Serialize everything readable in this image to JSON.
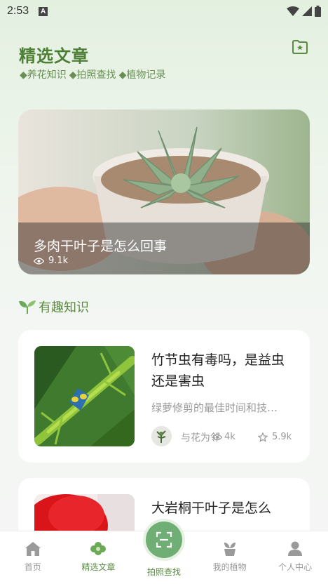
{
  "status": {
    "time": "2:53",
    "notif_letter": "A"
  },
  "header": {
    "title": "精选文章",
    "tags": [
      "◆养花知识",
      "◆拍照查找",
      "◆植物记录"
    ]
  },
  "hero": {
    "title": "多肉干叶子是怎么回事",
    "views": "9.1k"
  },
  "section": {
    "title": "有趣知识"
  },
  "cards": [
    {
      "title": "竹节虫有毒吗，是益虫还是害虫",
      "desc": "绿萝修剪的最佳时间和技…",
      "author": "与花为邻",
      "views": "4k",
      "stars": "5.9k"
    },
    {
      "title": "大岩桐干叶子是怎么"
    }
  ],
  "tabs": [
    {
      "label": "首页",
      "icon": "home-icon"
    },
    {
      "label": "精选文章",
      "icon": "flower-icon"
    },
    {
      "label": "拍照查找",
      "icon": "scan-icon"
    },
    {
      "label": "我的植物",
      "icon": "plant-icon"
    },
    {
      "label": "个人中心",
      "icon": "person-icon"
    }
  ],
  "colors": {
    "accent": "#5b8a43",
    "camera": "#6fae74"
  }
}
